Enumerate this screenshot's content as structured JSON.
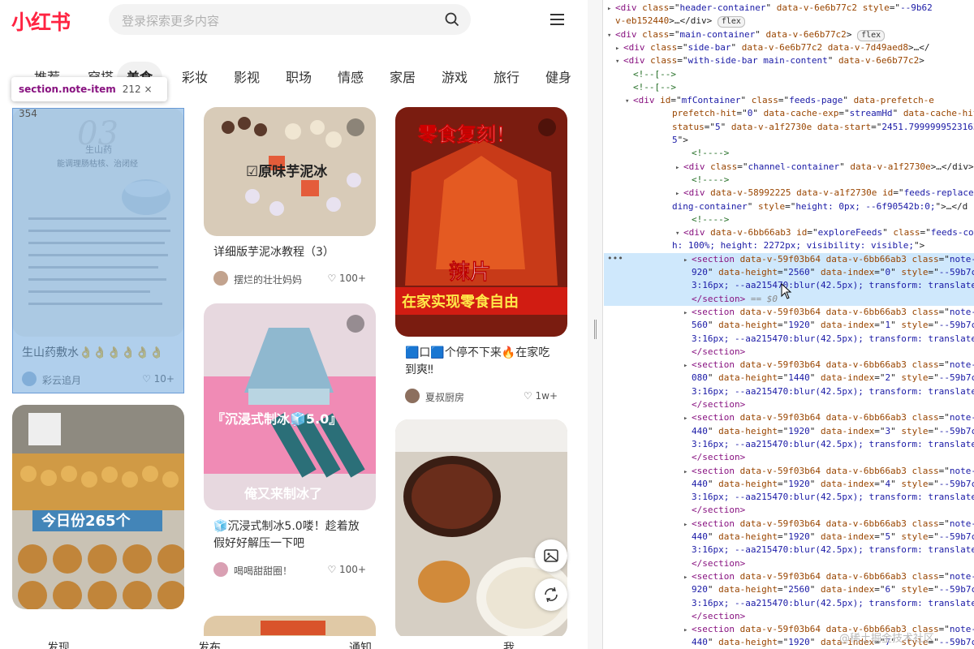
{
  "app": {
    "logo": "小红书",
    "search_placeholder": "登录探索更多内容",
    "tabs": [
      "推荐",
      "穿搭",
      "美食",
      "彩妆",
      "影视",
      "职场",
      "情感",
      "家居",
      "游戏",
      "旅行",
      "健身"
    ],
    "active_tab": "美食",
    "inspector_tooltip": {
      "selector": "section.note-item",
      "size": "212 × 354"
    },
    "cards": [
      {
        "title": "生山药敷水👌👌👌👌👌👌",
        "author": "彩云追月",
        "likes": "♡ 10+",
        "image_text": "03 生山药 能调理肠枯核，治闭经"
      },
      {
        "title": "详细版芋泥冰教程（3）",
        "author": "摆烂的壮壮妈妈",
        "likes": "♡ 100+",
        "image_text": "☑原味芋泥冰"
      },
      {
        "title": "🟦口🟦个停不下来🔥在家吃到爽‼",
        "author": "夏叔厨房",
        "likes": "♡ 1w+",
        "image_text_top": "零食复刻！",
        "image_text_mid": "辣片",
        "image_text_bot": "在家实现零食自由"
      },
      {
        "title": "今日份265个",
        "author": "",
        "likes": "",
        "image_text": "今日份265个"
      },
      {
        "title": "🧊沉浸式制冰5.0喽！趁着放假好好解压一下吧",
        "author": "喝喝甜甜圈！",
        "likes": "♡ 100+",
        "image_text_top": "『沉浸式制冰🧊5.0』",
        "image_text_bot": "俺又来制冰了"
      },
      {
        "title": "",
        "author": "",
        "likes": "",
        "image_text": ""
      }
    ],
    "bottom_nav": [
      "发现",
      "发布",
      "通知",
      "我"
    ]
  },
  "devtools": {
    "watermark": "@稀土掘金技术社区",
    "lines": [
      {
        "indent": 4,
        "tri": "▸",
        "html": "<span class='tn'>&lt;div</span> <span class='an'>class</span>=\"<span class='av'>header-container</span>\" <span class='an'>data-v-6e6b77c2</span> <span class='an'>style</span>=\"<span class='av'>--9b62</span>"
      },
      {
        "indent": 4,
        "tri": "",
        "html": "<span class='an'>v-eb152440</span>&gt;…&lt;/div&gt; <span class='badge'>flex</span>"
      },
      {
        "indent": 4,
        "tri": "▾",
        "html": "<span class='tn'>&lt;div</span> <span class='an'>class</span>=\"<span class='av'>main-container</span>\" <span class='an'>data-v-6e6b77c2</span>&gt; <span class='badge'>flex</span>"
      },
      {
        "indent": 14,
        "tri": "▸",
        "html": "<span class='tn'>&lt;div</span> <span class='an'>class</span>=\"<span class='av'>side-bar</span>\" <span class='an'>data-v-6e6b77c2</span> <span class='an'>data-v-7d49aed8</span>&gt;…&lt;/"
      },
      {
        "indent": 14,
        "tri": "▾",
        "html": "<span class='tn'>&lt;div</span> <span class='an'>class</span>=\"<span class='av'>with-side-bar main-content</span>\" <span class='an'>data-v-6e6b77c2</span>&gt;"
      },
      {
        "indent": 26,
        "tri": "",
        "html": "<span class='cm'>&lt;!--[--&gt;</span>"
      },
      {
        "indent": 26,
        "tri": "",
        "html": "<span class='cm'>&lt;!--[--&gt;</span>"
      },
      {
        "indent": 26,
        "tri": "▾",
        "html": "<span class='tn'>&lt;div</span> <span class='an'>id</span>=\"<span class='av'>mfContainer</span>\" <span class='an'>class</span>=\"<span class='av'>feeds-page</span>\" <span class='an'>data-prefetch-e</span>"
      },
      {
        "indent": 74,
        "tri": "",
        "html": "<span class='an'>prefetch-hit</span>=\"<span class='av'>0</span>\" <span class='an'>data-cache-exp</span>=\"<span class='av'>streamHd</span>\" <span class='an'>data-cache-hit</span>="
      },
      {
        "indent": 74,
        "tri": "",
        "html": "<span class='an'>status</span>=\"<span class='av'>5</span>\" <span class='an'>data-v-a1f2730e</span> <span class='an'>data-start</span>=\"<span class='av'>2451.7999999523163</span>\""
      },
      {
        "indent": 74,
        "tri": "",
        "html": "<span class='av'>5</span>\"&gt;"
      },
      {
        "indent": 98,
        "tri": "",
        "html": "<span class='cm'>&lt;!----&gt;</span>"
      },
      {
        "indent": 88,
        "tri": "▸",
        "html": "<span class='tn'>&lt;div</span> <span class='an'>class</span>=\"<span class='av'>channel-container</span>\" <span class='an'>data-v-a1f2730e</span>&gt;…&lt;/div&gt;"
      },
      {
        "indent": 98,
        "tri": "",
        "html": "<span class='cm'>&lt;!----&gt;</span>"
      },
      {
        "indent": 88,
        "tri": "▸",
        "html": "<span class='tn'>&lt;div</span> <span class='an'>data-v-58992225</span> <span class='an'>data-v-a1f2730e</span> <span class='an'>id</span>=\"<span class='av'>feeds-replace</span>"
      },
      {
        "indent": 74,
        "tri": "",
        "html": "<span class='av'>ding-container</span>\" <span class='an'>style</span>=\"<span class='av'>height: 0px; --6f90542b:0;</span>\"&gt;…&lt;/d"
      },
      {
        "indent": 98,
        "tri": "",
        "html": "<span class='cm'>&lt;!----&gt;</span>"
      },
      {
        "indent": 88,
        "tri": "▾",
        "html": "<span class='tn'>&lt;div</span> <span class='an'>data-v-6bb66ab3</span> <span class='an'>id</span>=\"<span class='av'>exploreFeeds</span>\" <span class='an'>class</span>=\"<span class='av'>feeds-con</span>"
      },
      {
        "indent": 74,
        "tri": "",
        "html": "<span class='av'>h: 100%; height: 2272px; visibility: visible;</span>\"&gt;"
      },
      {
        "indent": 98,
        "tri": "▸",
        "sel": true,
        "html": "<span class='tn'>&lt;section</span> <span class='an'>data-v-59f03b64</span> <span class='an'>data-v-6bb66ab3</span> <span class='an'>class</span>=\"<span class='av'>note-</span>"
      },
      {
        "indent": 98,
        "tri": "",
        "sel": true,
        "html": "<span class='av'>920</span>\" <span class='an'>data-height</span>=\"<span class='av'>2560</span>\" <span class='an'>data-index</span>=\"<span class='av'>0</span>\" <span class='an'>style</span>=\"<span class='av'>--59b7c9</span>"
      },
      {
        "indent": 98,
        "tri": "",
        "sel": true,
        "html": "<span class='av'>3:16px; --aa215470:blur(42.5px); transform: translate(</span>"
      },
      {
        "indent": 98,
        "tri": "",
        "sel": true,
        "html": "<span class='tn'>&lt;/section&gt;</span> <span class='eq0'>== $0</span>"
      },
      {
        "indent": 98,
        "tri": "▸",
        "html": "<span class='tn'>&lt;section</span> <span class='an'>data-v-59f03b64</span> <span class='an'>data-v-6bb66ab3</span> <span class='an'>class</span>=\"<span class='av'>note-</span>"
      },
      {
        "indent": 98,
        "tri": "",
        "html": "<span class='av'>560</span>\" <span class='an'>data-height</span>=\"<span class='av'>1920</span>\" <span class='an'>data-index</span>=\"<span class='av'>1</span>\" <span class='an'>style</span>=\"<span class='av'>--59b7c9</span>"
      },
      {
        "indent": 98,
        "tri": "",
        "html": "<span class='av'>3:16px; --aa215470:blur(42.5px); transform: translate(</span>"
      },
      {
        "indent": 98,
        "tri": "",
        "html": "<span class='tn'>&lt;/section&gt;</span>"
      },
      {
        "indent": 98,
        "tri": "▸",
        "html": "<span class='tn'>&lt;section</span> <span class='an'>data-v-59f03b64</span> <span class='an'>data-v-6bb66ab3</span> <span class='an'>class</span>=\"<span class='av'>note-</span>"
      },
      {
        "indent": 98,
        "tri": "",
        "html": "<span class='av'>080</span>\" <span class='an'>data-height</span>=\"<span class='av'>1440</span>\" <span class='an'>data-index</span>=\"<span class='av'>2</span>\" <span class='an'>style</span>=\"<span class='av'>--59b7c9</span>"
      },
      {
        "indent": 98,
        "tri": "",
        "html": "<span class='av'>3:16px; --aa215470:blur(42.5px); transform: translate(</span>"
      },
      {
        "indent": 98,
        "tri": "",
        "html": "<span class='tn'>&lt;/section&gt;</span>"
      },
      {
        "indent": 98,
        "tri": "▸",
        "html": "<span class='tn'>&lt;section</span> <span class='an'>data-v-59f03b64</span> <span class='an'>data-v-6bb66ab3</span> <span class='an'>class</span>=\"<span class='av'>note-</span>"
      },
      {
        "indent": 98,
        "tri": "",
        "html": "<span class='av'>440</span>\" <span class='an'>data-height</span>=\"<span class='av'>1920</span>\" <span class='an'>data-index</span>=\"<span class='av'>3</span>\" <span class='an'>style</span>=\"<span class='av'>--59b7c9</span>"
      },
      {
        "indent": 98,
        "tri": "",
        "html": "<span class='av'>3:16px; --aa215470:blur(42.5px); transform: translate(</span>"
      },
      {
        "indent": 98,
        "tri": "",
        "html": "<span class='tn'>&lt;/section&gt;</span>"
      },
      {
        "indent": 98,
        "tri": "▸",
        "html": "<span class='tn'>&lt;section</span> <span class='an'>data-v-59f03b64</span> <span class='an'>data-v-6bb66ab3</span> <span class='an'>class</span>=\"<span class='av'>note-</span>"
      },
      {
        "indent": 98,
        "tri": "",
        "html": "<span class='av'>440</span>\" <span class='an'>data-height</span>=\"<span class='av'>1920</span>\" <span class='an'>data-index</span>=\"<span class='av'>4</span>\" <span class='an'>style</span>=\"<span class='av'>--59b7c9</span>"
      },
      {
        "indent": 98,
        "tri": "",
        "html": "<span class='av'>3:16px; --aa215470:blur(42.5px); transform: translate(</span>"
      },
      {
        "indent": 98,
        "tri": "",
        "html": "<span class='tn'>&lt;/section&gt;</span>"
      },
      {
        "indent": 98,
        "tri": "▸",
        "html": "<span class='tn'>&lt;section</span> <span class='an'>data-v-59f03b64</span> <span class='an'>data-v-6bb66ab3</span> <span class='an'>class</span>=\"<span class='av'>note-</span>"
      },
      {
        "indent": 98,
        "tri": "",
        "html": "<span class='av'>440</span>\" <span class='an'>data-height</span>=\"<span class='av'>1920</span>\" <span class='an'>data-index</span>=\"<span class='av'>5</span>\" <span class='an'>style</span>=\"<span class='av'>--59b7c9</span>"
      },
      {
        "indent": 98,
        "tri": "",
        "html": "<span class='av'>3:16px; --aa215470:blur(42.5px); transform: translate(</span>"
      },
      {
        "indent": 98,
        "tri": "",
        "html": "<span class='tn'>&lt;/section&gt;</span>"
      },
      {
        "indent": 98,
        "tri": "▸",
        "html": "<span class='tn'>&lt;section</span> <span class='an'>data-v-59f03b64</span> <span class='an'>data-v-6bb66ab3</span> <span class='an'>class</span>=\"<span class='av'>note-</span>"
      },
      {
        "indent": 98,
        "tri": "",
        "html": "<span class='av'>920</span>\" <span class='an'>data-height</span>=\"<span class='av'>2560</span>\" <span class='an'>data-index</span>=\"<span class='av'>6</span>\" <span class='an'>style</span>=\"<span class='av'>--59b7c9</span>"
      },
      {
        "indent": 98,
        "tri": "",
        "html": "<span class='av'>3:16px; --aa215470:blur(42.5px); transform: translate(</span>"
      },
      {
        "indent": 98,
        "tri": "",
        "html": "<span class='tn'>&lt;/section&gt;</span>"
      },
      {
        "indent": 98,
        "tri": "▸",
        "html": "<span class='tn'>&lt;section</span> <span class='an'>data-v-59f03b64</span> <span class='an'>data-v-6bb66ab3</span> <span class='an'>class</span>=\"<span class='av'>note-</span>"
      },
      {
        "indent": 98,
        "tri": "",
        "html": "<span class='av'>440</span>\" <span class='an'>data-height</span>=\"<span class='av'>1920</span>\" <span class='an'>data-index</span>=\"<span class='av'>7</span>\" <span class='an'>style</span>=\"<span class='av'>--59b7c9</span>"
      }
    ]
  }
}
